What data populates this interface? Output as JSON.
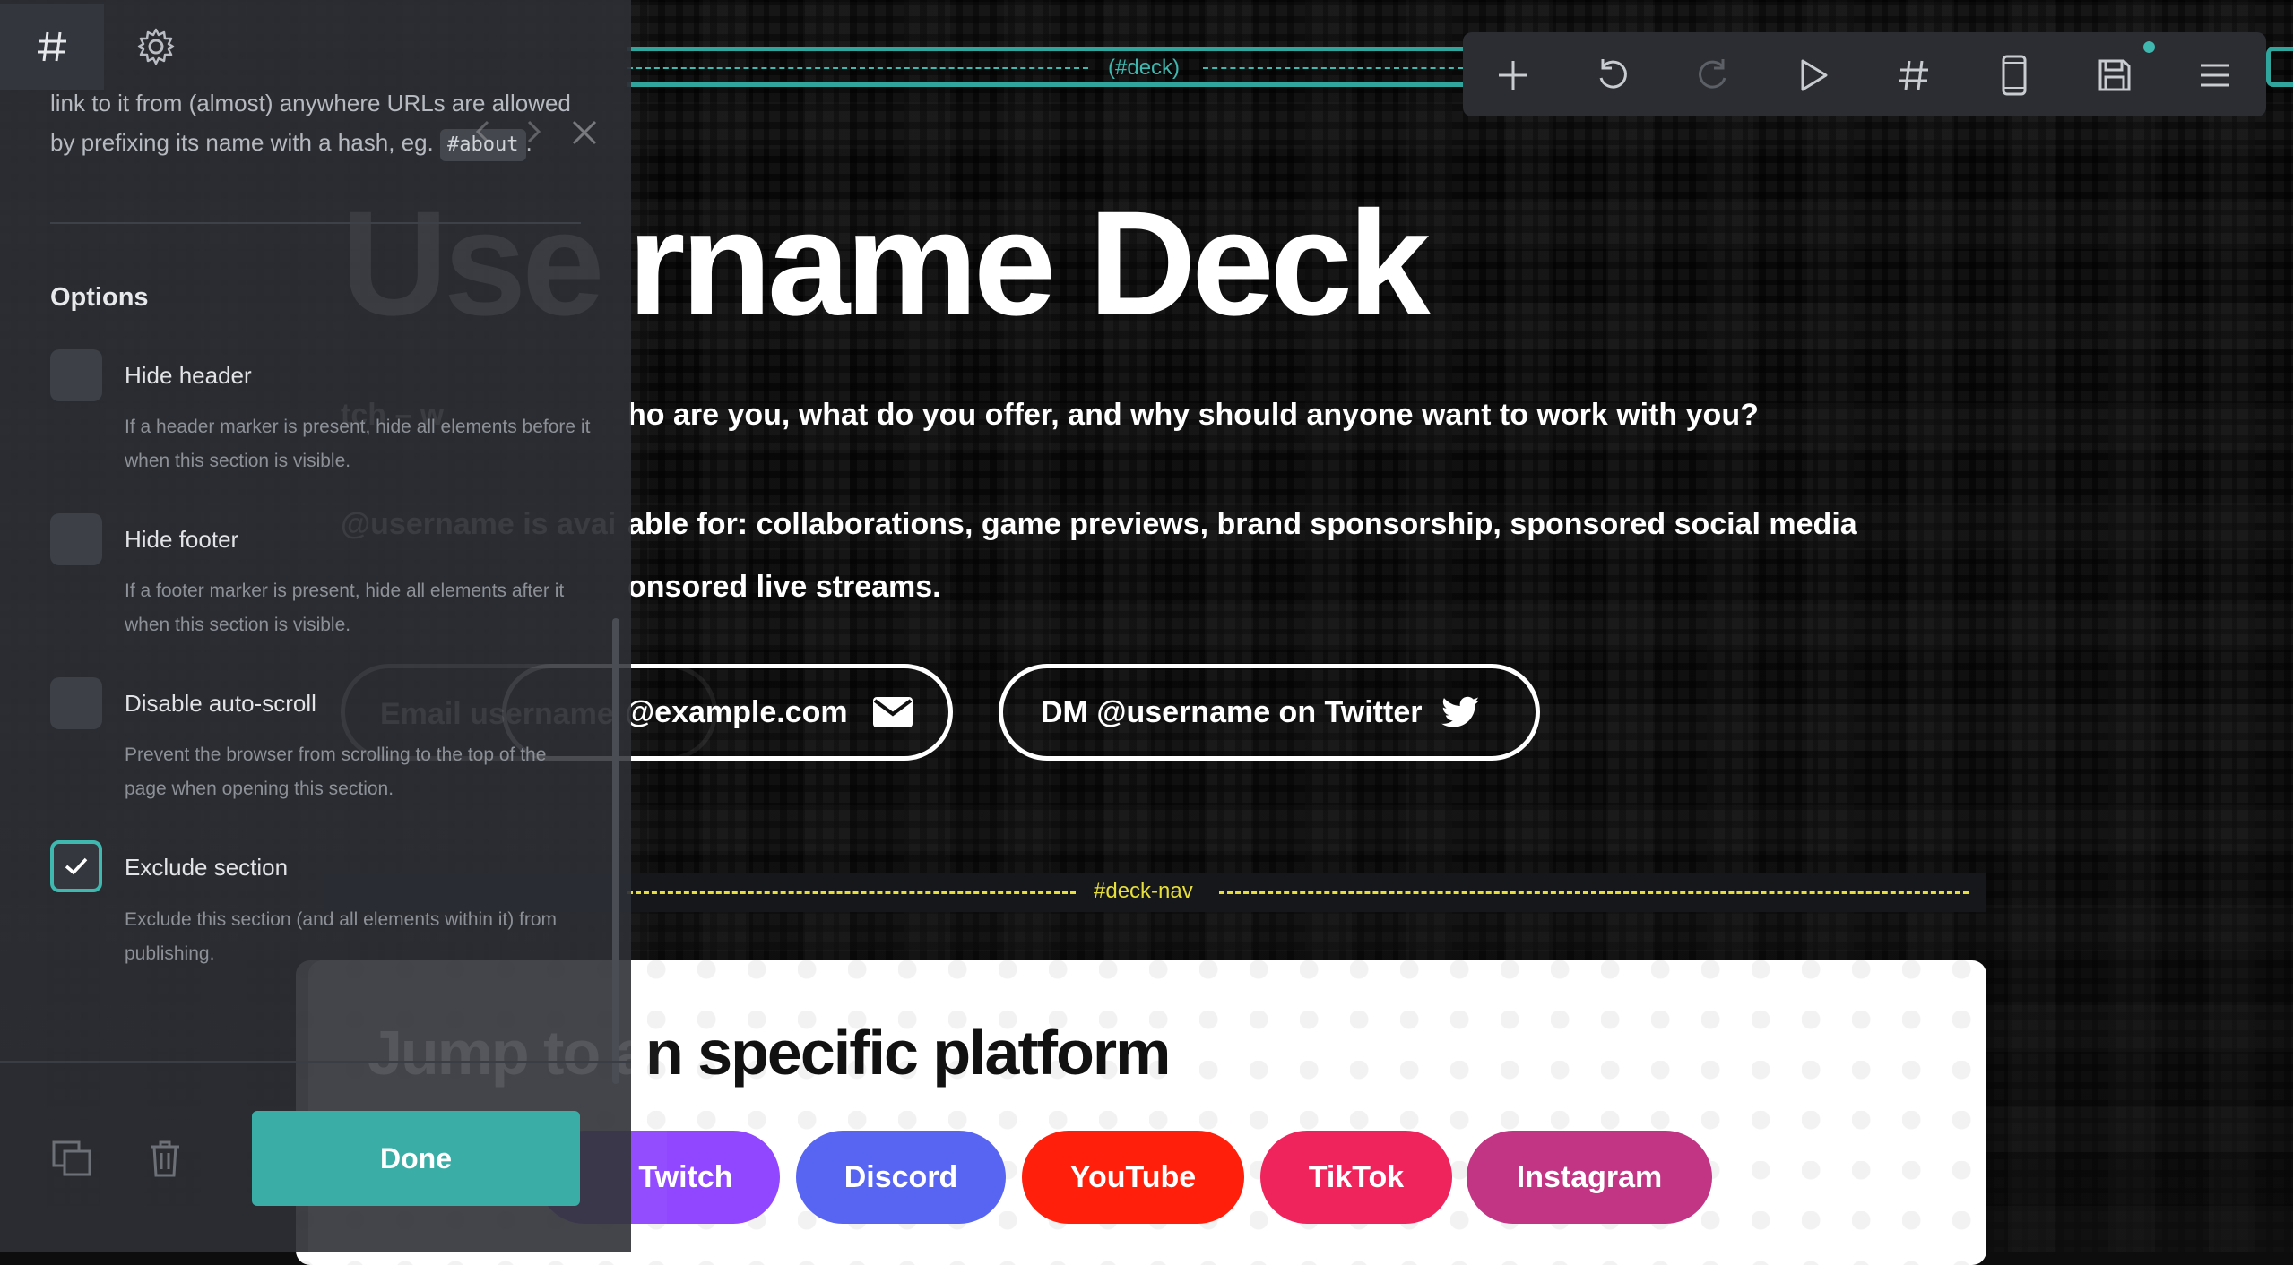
{
  "canvas": {
    "deck_marker": "(#deck)",
    "deck_nav_marker": "#deck-nav",
    "title": "rname Deck",
    "ghost_title": "Use",
    "tagline": "ho are you, what do you offer, and why should anyone want to work with you?",
    "ghost_tagline": "tch – w",
    "availability_line1": "able for: collaborations, game previews, brand sponsorship, sponsored social media",
    "ghost_availability": "@username is avai",
    "availability_line2": "onsored live streams.",
    "email_button": "@example.com",
    "ghost_email": "Email username",
    "twitter_button": "DM @username on Twitter",
    "platform_title": "n specific platform",
    "ghost_platform_title": "Jump to a",
    "platforms": [
      {
        "label": "Twitch",
        "color": "#9146ff"
      },
      {
        "label": "Discord",
        "color": "#5865f2"
      },
      {
        "label": "YouTube",
        "color": "#ff1f0a"
      },
      {
        "label": "TikTok",
        "color": "#f0245c"
      },
      {
        "label": "Instagram",
        "color": "#c13584"
      }
    ]
  },
  "toolbar": {
    "icons": [
      "plus-icon",
      "undo-icon",
      "redo-icon",
      "play-icon",
      "hash-icon",
      "mobile-icon",
      "save-icon",
      "menu-icon"
    ],
    "accent": "#3fb8b0"
  },
  "panel": {
    "tabs": [
      "hash-icon",
      "gear-icon"
    ],
    "intro_line1": "link to it from (almost) anywhere URLs are allowed",
    "intro_line2": "by prefixing its name with a hash, eg.",
    "intro_code": "#about",
    "intro_end": ".",
    "options_title": "Options",
    "options": [
      {
        "label": "Hide header",
        "desc": "If a header marker is present, hide all elements before it when this section is visible.",
        "checked": false
      },
      {
        "label": "Hide footer",
        "desc": "If a footer marker is present, hide all elements after it when this section is visible.",
        "checked": false
      },
      {
        "label": "Disable auto-scroll",
        "desc": "Prevent the browser from scrolling to the top of the page when opening this section.",
        "checked": false
      },
      {
        "label": "Exclude section",
        "desc": "Exclude this section (and all elements within it) from publishing.",
        "checked": true
      }
    ],
    "done_label": "Done",
    "accent": "#3aaea6"
  }
}
